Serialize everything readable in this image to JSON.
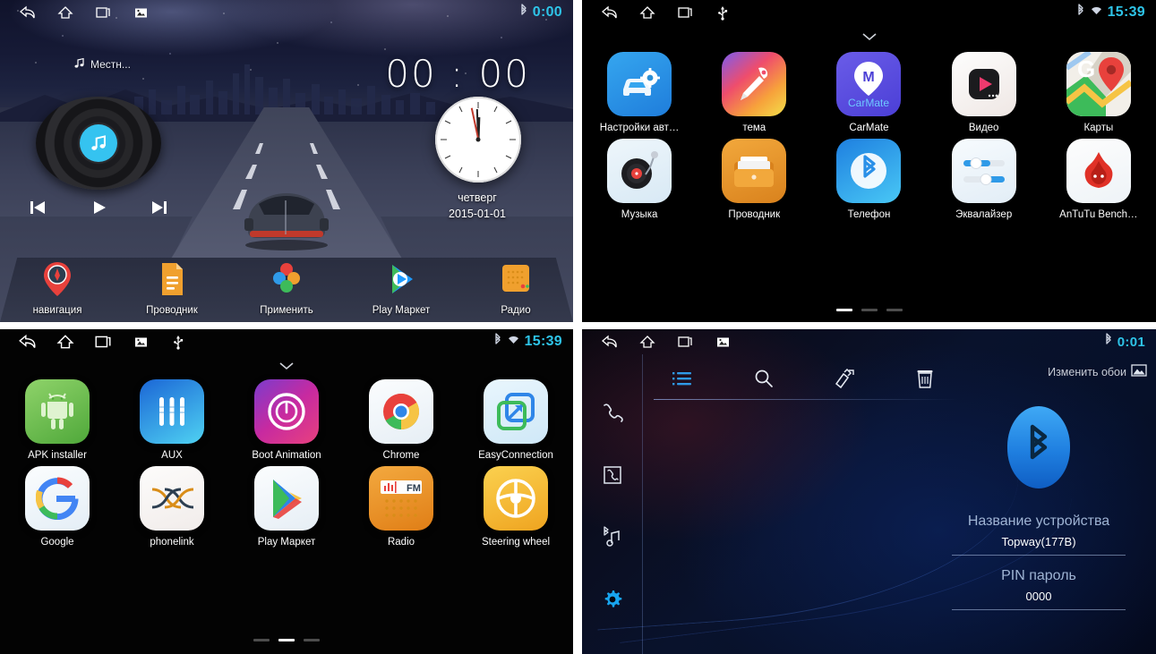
{
  "panels": {
    "home": {
      "statusbar": {
        "nav_icons": [
          "back-icon",
          "home-icon",
          "recents-icon",
          "screenshot-icon"
        ],
        "status_icons": [
          "bluetooth-icon"
        ],
        "clock": "0:00"
      },
      "now_playing": {
        "icon": "music-note-icon",
        "title": "Местн..."
      },
      "digital_clock": "00 : 00",
      "date": {
        "weekday": "четверг",
        "date": "2015-01-01"
      },
      "media_controls": [
        "prev-track-icon",
        "play-icon",
        "next-track-icon"
      ],
      "dock": [
        {
          "label": "навигация",
          "icon": "navigation-pin-icon"
        },
        {
          "label": "Проводник",
          "icon": "file-manager-icon"
        },
        {
          "label": "Применить",
          "icon": "apply-flower-icon"
        },
        {
          "label": "Play Маркет",
          "icon": "play-store-icon"
        },
        {
          "label": "Радио",
          "icon": "radio-icon"
        }
      ]
    },
    "apps_page1": {
      "statusbar": {
        "nav_icons": [
          "back-icon",
          "home-icon",
          "recents-icon",
          "usb-icon"
        ],
        "status_icons": [
          "bluetooth-icon",
          "wifi-icon"
        ],
        "clock": "15:39"
      },
      "rows": [
        [
          {
            "label": "Настройки авт…",
            "icon": "car-settings-icon"
          },
          {
            "label": "тема",
            "icon": "theme-brush-icon"
          },
          {
            "label": "CarMate",
            "icon": "carmate-icon"
          },
          {
            "label": "Видео",
            "icon": "video-player-icon"
          },
          {
            "label": "Карты",
            "icon": "google-maps-icon"
          }
        ],
        [
          {
            "label": "Музыка",
            "icon": "music-turntable-icon"
          },
          {
            "label": "Проводник",
            "icon": "file-manager-icon"
          },
          {
            "label": "Телефон",
            "icon": "bluetooth-phone-icon"
          },
          {
            "label": "Эквалайзер",
            "icon": "equalizer-icon"
          },
          {
            "label": "AnTuTu Bench…",
            "icon": "antutu-flame-icon"
          }
        ]
      ],
      "page_dots": {
        "count": 3,
        "active": 0
      }
    },
    "apps_page2": {
      "statusbar": {
        "nav_icons": [
          "back-icon",
          "home-icon",
          "recents-icon",
          "screenshot-icon",
          "usb-icon"
        ],
        "status_icons": [
          "bluetooth-icon",
          "wifi-icon"
        ],
        "clock": "15:39"
      },
      "rows": [
        [
          {
            "label": "APK installer",
            "icon": "android-robot-icon"
          },
          {
            "label": "AUX",
            "icon": "aux-jack-icon"
          },
          {
            "label": "Boot Animation",
            "icon": "power-ring-icon"
          },
          {
            "label": "Chrome",
            "icon": "chrome-icon"
          },
          {
            "label": "EasyConnection",
            "icon": "easyconnection-icon"
          }
        ],
        [
          {
            "label": "Google",
            "icon": "google-g-icon"
          },
          {
            "label": "phonelink",
            "icon": "phonelink-xx-icon"
          },
          {
            "label": "Play Маркет",
            "icon": "play-store-icon"
          },
          {
            "label": "Radio",
            "icon": "fm-radio-icon"
          },
          {
            "label": "Steering wheel",
            "icon": "steering-wheel-icon"
          }
        ]
      ],
      "page_dots": {
        "count": 3,
        "active": 1
      }
    },
    "bluetooth": {
      "statusbar": {
        "nav_icons": [
          "back-icon",
          "home-icon",
          "recents-icon",
          "screenshot-icon"
        ],
        "status_icons": [
          "bluetooth-icon"
        ],
        "clock": "0:01"
      },
      "sidebar": [
        {
          "icon": "dialer-handset-icon",
          "active": false
        },
        {
          "icon": "contacts-book-icon",
          "active": false
        },
        {
          "icon": "bluetooth-music-icon",
          "active": false
        },
        {
          "icon": "settings-gear-icon",
          "active": true
        }
      ],
      "toolbar": [
        {
          "icon": "list-icon",
          "active": true
        },
        {
          "icon": "search-icon",
          "active": false
        },
        {
          "icon": "edit-select-icon",
          "active": false
        },
        {
          "icon": "trash-icon",
          "active": false
        }
      ],
      "wallpaper_button": {
        "label": "Изменить обои",
        "icon": "wallpaper-icon"
      },
      "logo_icon": "bluetooth-logo-icon",
      "fields": [
        {
          "label": "Название устройства",
          "value": "Topway(177B)"
        },
        {
          "label": "PIN пароль",
          "value": "0000"
        }
      ]
    }
  },
  "colors": {
    "accent_cyan": "#2ec4e8",
    "accent_blue": "#1e9bff",
    "bluetooth_blue": "#2f9ae8",
    "panel_black": "#000000"
  }
}
